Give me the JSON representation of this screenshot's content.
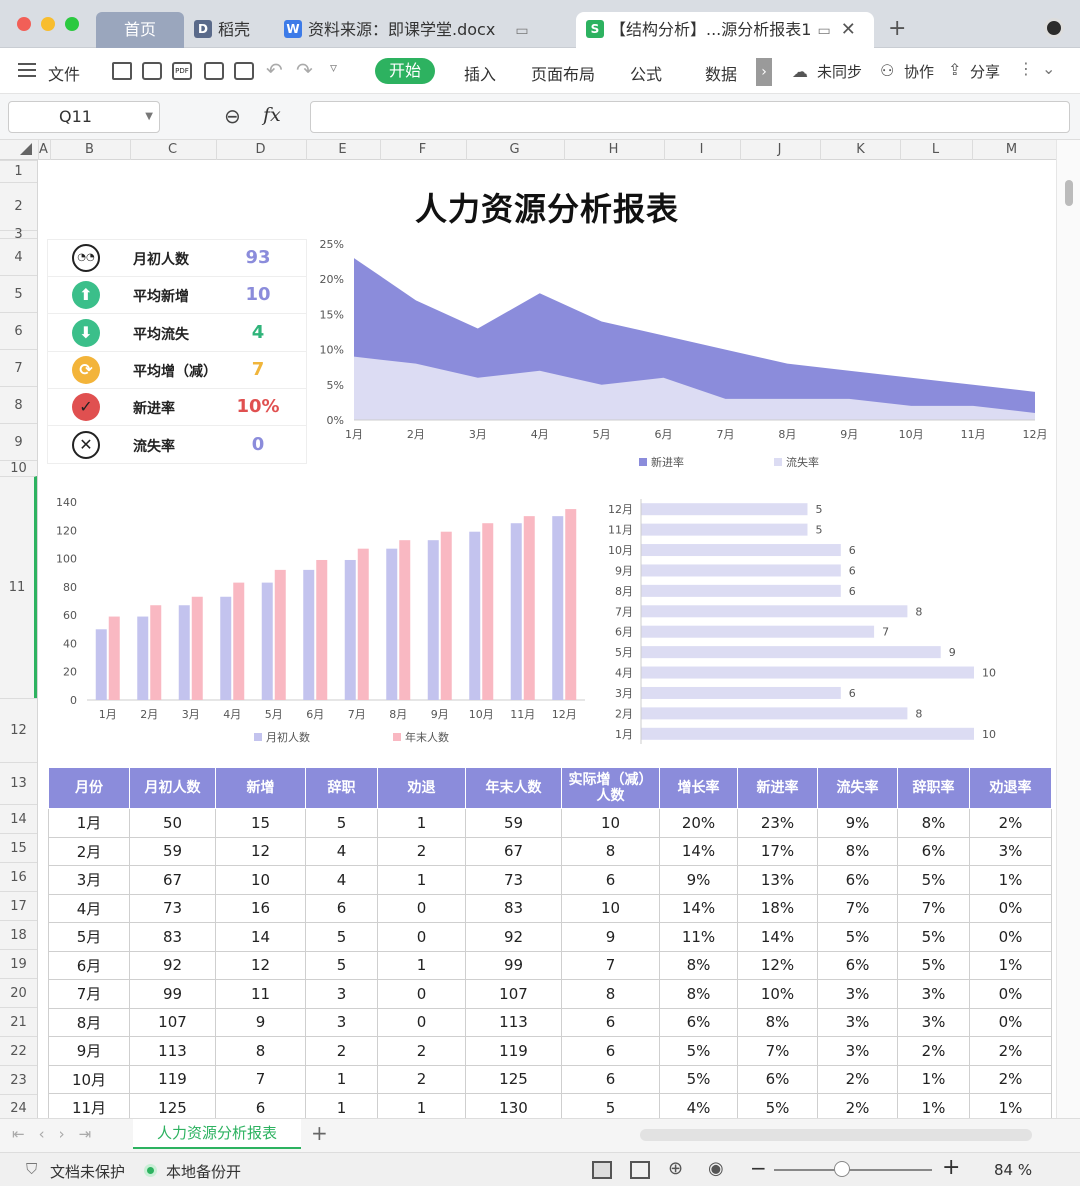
{
  "window": {
    "tabs": [
      {
        "label": "首页"
      },
      {
        "label": "稻壳"
      },
      {
        "label": "资料来源：即课学堂.docx"
      },
      {
        "label": "【结构分析】...源分析报表1"
      }
    ]
  },
  "menu": {
    "file": "文件",
    "start": "开始",
    "items": [
      "插入",
      "页面布局",
      "公式",
      "数据"
    ],
    "sync": "未同步",
    "collab": "协作",
    "share": "分享"
  },
  "formula_bar": {
    "cell_ref": "Q11",
    "fx": "fx",
    "content": ""
  },
  "columns": [
    "A",
    "B",
    "C",
    "D",
    "E",
    "F",
    "G",
    "H",
    "I",
    "J",
    "K",
    "L",
    "M"
  ],
  "rows": [
    "1",
    "2",
    "3",
    "4",
    "5",
    "6",
    "7",
    "8",
    "9",
    "10",
    "11",
    "12",
    "13",
    "14",
    "15",
    "16",
    "17",
    "18",
    "19",
    "20",
    "21",
    "22",
    "23",
    "24"
  ],
  "report": {
    "title": "人力资源分析报表",
    "kpis": [
      {
        "label": "月初人数",
        "value": "93",
        "icon": "face-icon",
        "color": "#8b8cdb"
      },
      {
        "label": "平均新增",
        "value": "10",
        "icon": "arrow-up-icon",
        "color": "#8b8cdb"
      },
      {
        "label": "平均流失",
        "value": "4",
        "icon": "arrow-down-icon",
        "color": "#2fb47a"
      },
      {
        "label": "平均增（减）",
        "value": "7",
        "icon": "refresh-icon",
        "color": "#f0b53b"
      },
      {
        "label": "新进率",
        "value": "10%",
        "icon": "check-icon",
        "color": "#e05050"
      },
      {
        "label": "流失率",
        "value": "0",
        "icon": "cross-icon",
        "color": "#8b8cdb"
      }
    ],
    "table": {
      "headers": [
        "月份",
        "月初人数",
        "新增",
        "辞职",
        "劝退",
        "年末人数",
        "实际增（减）人数",
        "增长率",
        "新进率",
        "流失率",
        "辞职率",
        "劝退率"
      ],
      "rows": [
        [
          "1月",
          "50",
          "15",
          "5",
          "1",
          "59",
          "10",
          "20%",
          "23%",
          "9%",
          "8%",
          "2%"
        ],
        [
          "2月",
          "59",
          "12",
          "4",
          "2",
          "67",
          "8",
          "14%",
          "17%",
          "8%",
          "6%",
          "3%"
        ],
        [
          "3月",
          "67",
          "10",
          "4",
          "1",
          "73",
          "6",
          "9%",
          "13%",
          "6%",
          "5%",
          "1%"
        ],
        [
          "4月",
          "73",
          "16",
          "6",
          "0",
          "83",
          "10",
          "14%",
          "18%",
          "7%",
          "7%",
          "0%"
        ],
        [
          "5月",
          "83",
          "14",
          "5",
          "0",
          "92",
          "9",
          "11%",
          "14%",
          "5%",
          "5%",
          "0%"
        ],
        [
          "6月",
          "92",
          "12",
          "5",
          "1",
          "99",
          "7",
          "8%",
          "12%",
          "6%",
          "5%",
          "1%"
        ],
        [
          "7月",
          "99",
          "11",
          "3",
          "0",
          "107",
          "8",
          "8%",
          "10%",
          "3%",
          "3%",
          "0%"
        ],
        [
          "8月",
          "107",
          "9",
          "3",
          "0",
          "113",
          "6",
          "6%",
          "8%",
          "3%",
          "3%",
          "0%"
        ],
        [
          "9月",
          "113",
          "8",
          "2",
          "2",
          "119",
          "6",
          "5%",
          "7%",
          "3%",
          "2%",
          "2%"
        ],
        [
          "10月",
          "119",
          "7",
          "1",
          "2",
          "125",
          "6",
          "5%",
          "6%",
          "2%",
          "1%",
          "2%"
        ],
        [
          "11月",
          "125",
          "6",
          "1",
          "1",
          "130",
          "5",
          "4%",
          "5%",
          "2%",
          "1%",
          "1%"
        ]
      ]
    }
  },
  "chart_data": [
    {
      "type": "area",
      "categories": [
        "1月",
        "2月",
        "3月",
        "4月",
        "5月",
        "6月",
        "7月",
        "8月",
        "9月",
        "10月",
        "11月",
        "12月"
      ],
      "series": [
        {
          "name": "新进率",
          "values": [
            23,
            17,
            13,
            18,
            14,
            12,
            10,
            8,
            7,
            6,
            5,
            4
          ],
          "color": "#8b8cdb"
        },
        {
          "name": "流失率",
          "values": [
            9,
            8,
            6,
            7,
            5,
            6,
            3,
            3,
            3,
            2,
            2,
            1
          ],
          "color": "#dcdcf3"
        }
      ],
      "ylim": [
        0,
        25
      ],
      "yticks": [
        "0%",
        "5%",
        "10%",
        "15%",
        "20%",
        "25%"
      ],
      "legend": "bottom"
    },
    {
      "type": "bar",
      "categories": [
        "1月",
        "2月",
        "3月",
        "4月",
        "5月",
        "6月",
        "7月",
        "8月",
        "9月",
        "10月",
        "11月",
        "12月"
      ],
      "series": [
        {
          "name": "月初人数",
          "values": [
            50,
            59,
            67,
            73,
            83,
            92,
            99,
            107,
            113,
            119,
            125,
            130
          ],
          "color": "#c3c3ee"
        },
        {
          "name": "年末人数",
          "values": [
            59,
            67,
            73,
            83,
            92,
            99,
            107,
            113,
            119,
            125,
            130,
            135
          ],
          "color": "#f9b8c2"
        }
      ],
      "ylim": [
        0,
        140
      ],
      "yticks": [
        "0",
        "20",
        "40",
        "60",
        "80",
        "100",
        "120",
        "140"
      ],
      "legend": "bottom"
    },
    {
      "type": "bar",
      "orientation": "horizontal",
      "categories": [
        "1月",
        "2月",
        "3月",
        "4月",
        "5月",
        "6月",
        "7月",
        "8月",
        "9月",
        "10月",
        "11月",
        "12月"
      ],
      "values": [
        10,
        8,
        6,
        10,
        9,
        7,
        8,
        6,
        6,
        6,
        5,
        5
      ],
      "color": "#dcdcf3",
      "xlim": [
        0,
        10
      ]
    }
  ],
  "sheet_tabs": {
    "active": "人力资源分析报表",
    "add": "+"
  },
  "status": {
    "protect": "文档未保护",
    "backup": "本地备份开",
    "zoom": "84 %"
  }
}
